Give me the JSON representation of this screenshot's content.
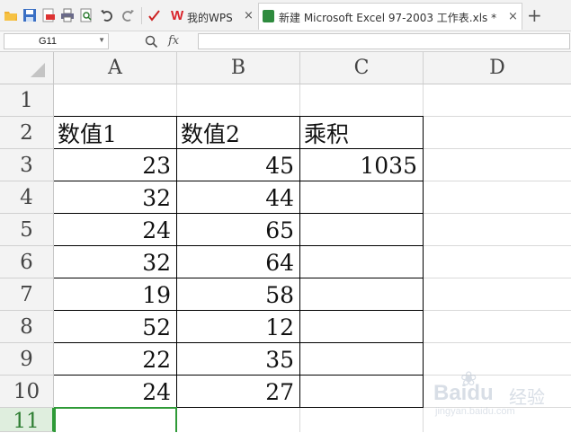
{
  "toolbar": {
    "icons": [
      "open-folder-icon",
      "save-icon",
      "export-pdf-icon",
      "print-icon",
      "print-preview-icon",
      "undo-icon",
      "redo-icon",
      "format-painter-icon"
    ]
  },
  "tabs": [
    {
      "label": "我的WPS",
      "close": "×",
      "icon": "wps-logo-icon"
    },
    {
      "label": "新建 Microsoft Excel 97-2003 工作表.xls *",
      "close": "×",
      "icon": "excel-file-icon"
    }
  ],
  "new_tab_label": "+",
  "formula_bar": {
    "cell_ref": "G11",
    "fx_label": "fx",
    "value": ""
  },
  "columns": [
    "A",
    "B",
    "C",
    "D"
  ],
  "rows": [
    "1",
    "2",
    "3",
    "4",
    "5",
    "6",
    "7",
    "8",
    "9",
    "10",
    "11"
  ],
  "sheet": {
    "headers": [
      "数值1",
      "数值2",
      "乘积"
    ],
    "data": [
      [
        "23",
        "45",
        "1035"
      ],
      [
        "32",
        "44",
        ""
      ],
      [
        "24",
        "65",
        ""
      ],
      [
        "32",
        "64",
        ""
      ],
      [
        "19",
        "58",
        ""
      ],
      [
        "52",
        "12",
        ""
      ],
      [
        "22",
        "35",
        ""
      ],
      [
        "24",
        "27",
        ""
      ]
    ]
  },
  "watermark": {
    "brand": "Baidu",
    "sub": "经验",
    "url": "jingyan.baidu.com"
  },
  "colors": {
    "accent_green": "#2e9a37",
    "wps_red": "#d9232a"
  }
}
